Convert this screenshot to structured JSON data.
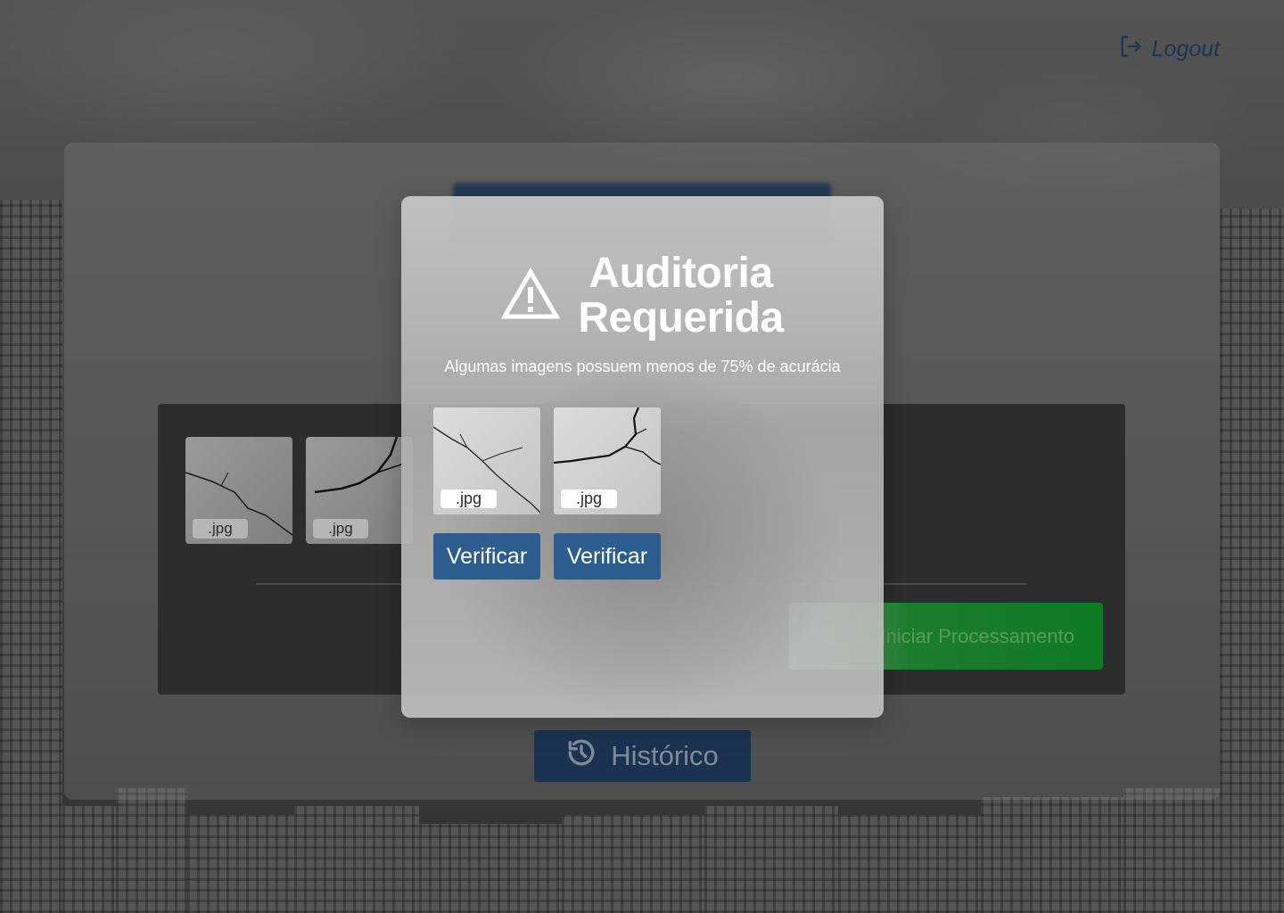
{
  "header": {
    "logout_label": "Logout"
  },
  "background_panel": {
    "files": [
      {
        "tag": ".jpg"
      },
      {
        "tag": ".jpg"
      }
    ],
    "start_button_label": "Iniciar Processamento",
    "history_button_label": "Histórico"
  },
  "modal": {
    "title_line1": "Auditoria",
    "title_line2": "Requerida",
    "subtitle": "Algumas imagens possuem menos de 75% de acurácia",
    "images": [
      {
        "tag": ".jpg",
        "button_label": "Verificar"
      },
      {
        "tag": ".jpg",
        "button_label": "Verificar"
      }
    ]
  },
  "colors": {
    "primary_blue": "#2d5d8f",
    "dark_blue": "#1b3350",
    "success_green": "#0f7a24",
    "icon": "warning-triangle-icon"
  }
}
